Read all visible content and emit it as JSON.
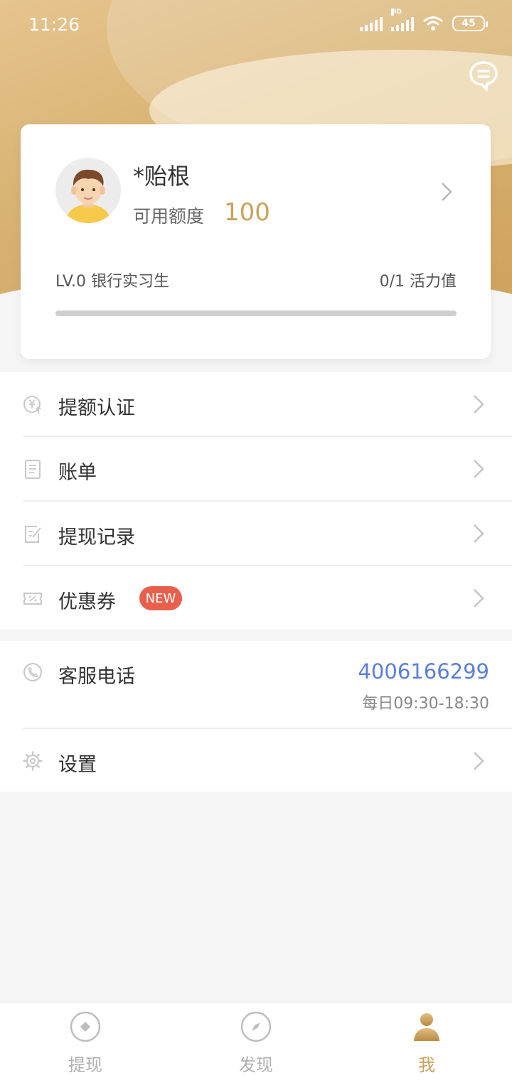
{
  "status_bar": {
    "time": "11:26",
    "battery": "45",
    "hd_label": "HD"
  },
  "profile": {
    "name": "*贻根",
    "credit_label": "可用额度",
    "credit_value": "100",
    "level": "LV.0 银行实习生",
    "vitality": "0/1 活力值",
    "vitality_progress": 0
  },
  "menu": {
    "items": [
      {
        "label": "提额认证",
        "icon": "yuan-up-icon"
      },
      {
        "label": "账单",
        "icon": "bill-icon"
      },
      {
        "label": "提现记录",
        "icon": "edit-record-icon"
      },
      {
        "label": "优惠券",
        "icon": "coupon-icon",
        "badge": "NEW"
      }
    ]
  },
  "service": {
    "label": "客服电话",
    "phone": "4006166299",
    "hours": "每日09:30-18:30"
  },
  "settings": {
    "label": "设置"
  },
  "tabbar": {
    "tabs": [
      {
        "label": "提现",
        "icon": "diamond-circle-icon",
        "active": false
      },
      {
        "label": "发现",
        "icon": "compass-icon",
        "active": false
      },
      {
        "label": "我",
        "icon": "person-icon",
        "active": true
      }
    ]
  },
  "colors": {
    "accent": "#c9a25b",
    "link": "#5b7fd6",
    "badge": "#e8604c"
  }
}
